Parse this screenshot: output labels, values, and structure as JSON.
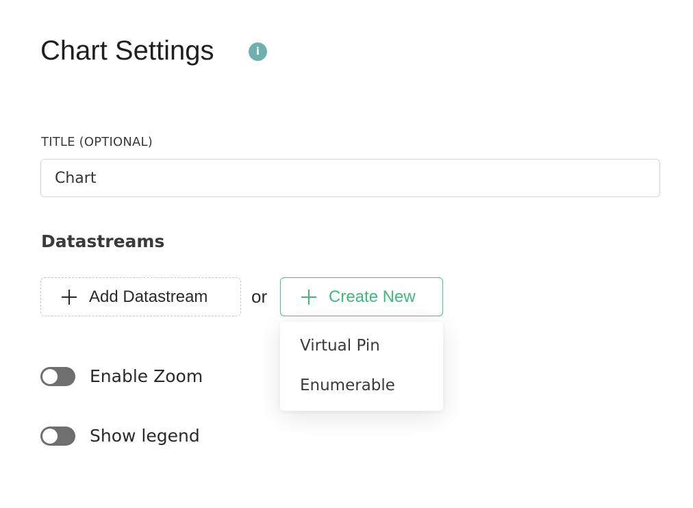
{
  "header": {
    "title": "Chart Settings",
    "info_icon": "info-icon",
    "info_glyph": "i"
  },
  "title_field": {
    "label": "TITLE (OPTIONAL)",
    "value": "Chart"
  },
  "datastreams": {
    "heading": "Datastreams",
    "add_label": "Add Datastream",
    "separator": "or",
    "create_label": "Create New",
    "menu_items": [
      "Virtual Pin",
      "Enumerable"
    ]
  },
  "toggles": [
    {
      "label": "Enable Zoom",
      "on": false
    },
    {
      "label": "Show legend",
      "on": false
    }
  ],
  "colors": {
    "accent": "#3fba7a",
    "info": "#6fafb0",
    "toggle_off": "#6e6e6e"
  }
}
